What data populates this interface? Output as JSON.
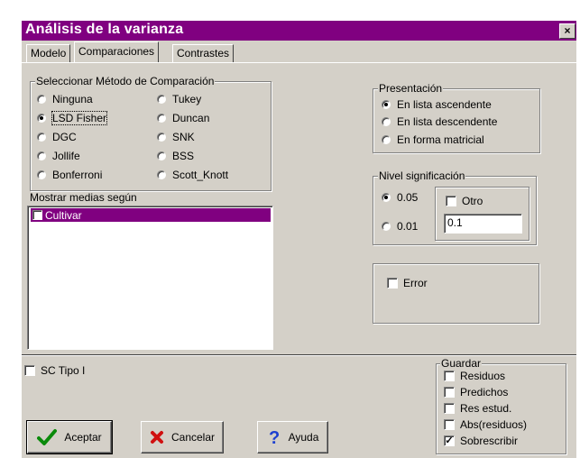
{
  "window": {
    "title": "Análisis de la varianza",
    "close_label": "×"
  },
  "tabs": [
    {
      "label": "Modelo",
      "active": false
    },
    {
      "label": "Comparaciones",
      "active": true
    },
    {
      "label": "Contrastes",
      "active": false
    }
  ],
  "method_group": {
    "legend": "Seleccionar Método de Comparación",
    "options": [
      "Ninguna",
      "LSD Fisher",
      "DGC",
      "Jollife",
      "Bonferroni",
      "Tukey",
      "Duncan",
      "SNK",
      "BSS",
      "Scott_Knott"
    ],
    "selected": "LSD Fisher"
  },
  "means_list": {
    "label": "Mostrar medias según",
    "items": [
      {
        "label": "Cultivar",
        "checked": false
      }
    ]
  },
  "presentation": {
    "legend": "Presentación",
    "options": [
      "En lista ascendente",
      "En lista descendente",
      "En forma matricial"
    ],
    "selected": "En lista ascendente"
  },
  "significance": {
    "legend": "Nivel significación",
    "options": [
      "0.05",
      "0.01"
    ],
    "selected": "0.05",
    "other_label": "Otro",
    "other_checked": false,
    "other_value": "0.1"
  },
  "error_option": {
    "label": "Error",
    "checked": false
  },
  "sc_tipo": {
    "label": "SC Tipo I",
    "checked": false
  },
  "save_group": {
    "legend": "Guardar",
    "items": [
      {
        "label": "Residuos",
        "checked": false
      },
      {
        "label": "Predichos",
        "checked": false
      },
      {
        "label": "Res estud.",
        "checked": false
      },
      {
        "label": "Abs(residuos)",
        "checked": false
      },
      {
        "label": "Sobrescribir",
        "checked": true
      }
    ]
  },
  "buttons": {
    "accept": "Aceptar",
    "cancel": "Cancelar",
    "help": "Ayuda"
  },
  "colors": {
    "title_bg": "#800080",
    "dialog_bg": "#d4d0c8",
    "selection": "#800080"
  },
  "icons": {
    "accept": "checkmark-icon",
    "cancel": "x-icon",
    "help": "question-icon"
  }
}
